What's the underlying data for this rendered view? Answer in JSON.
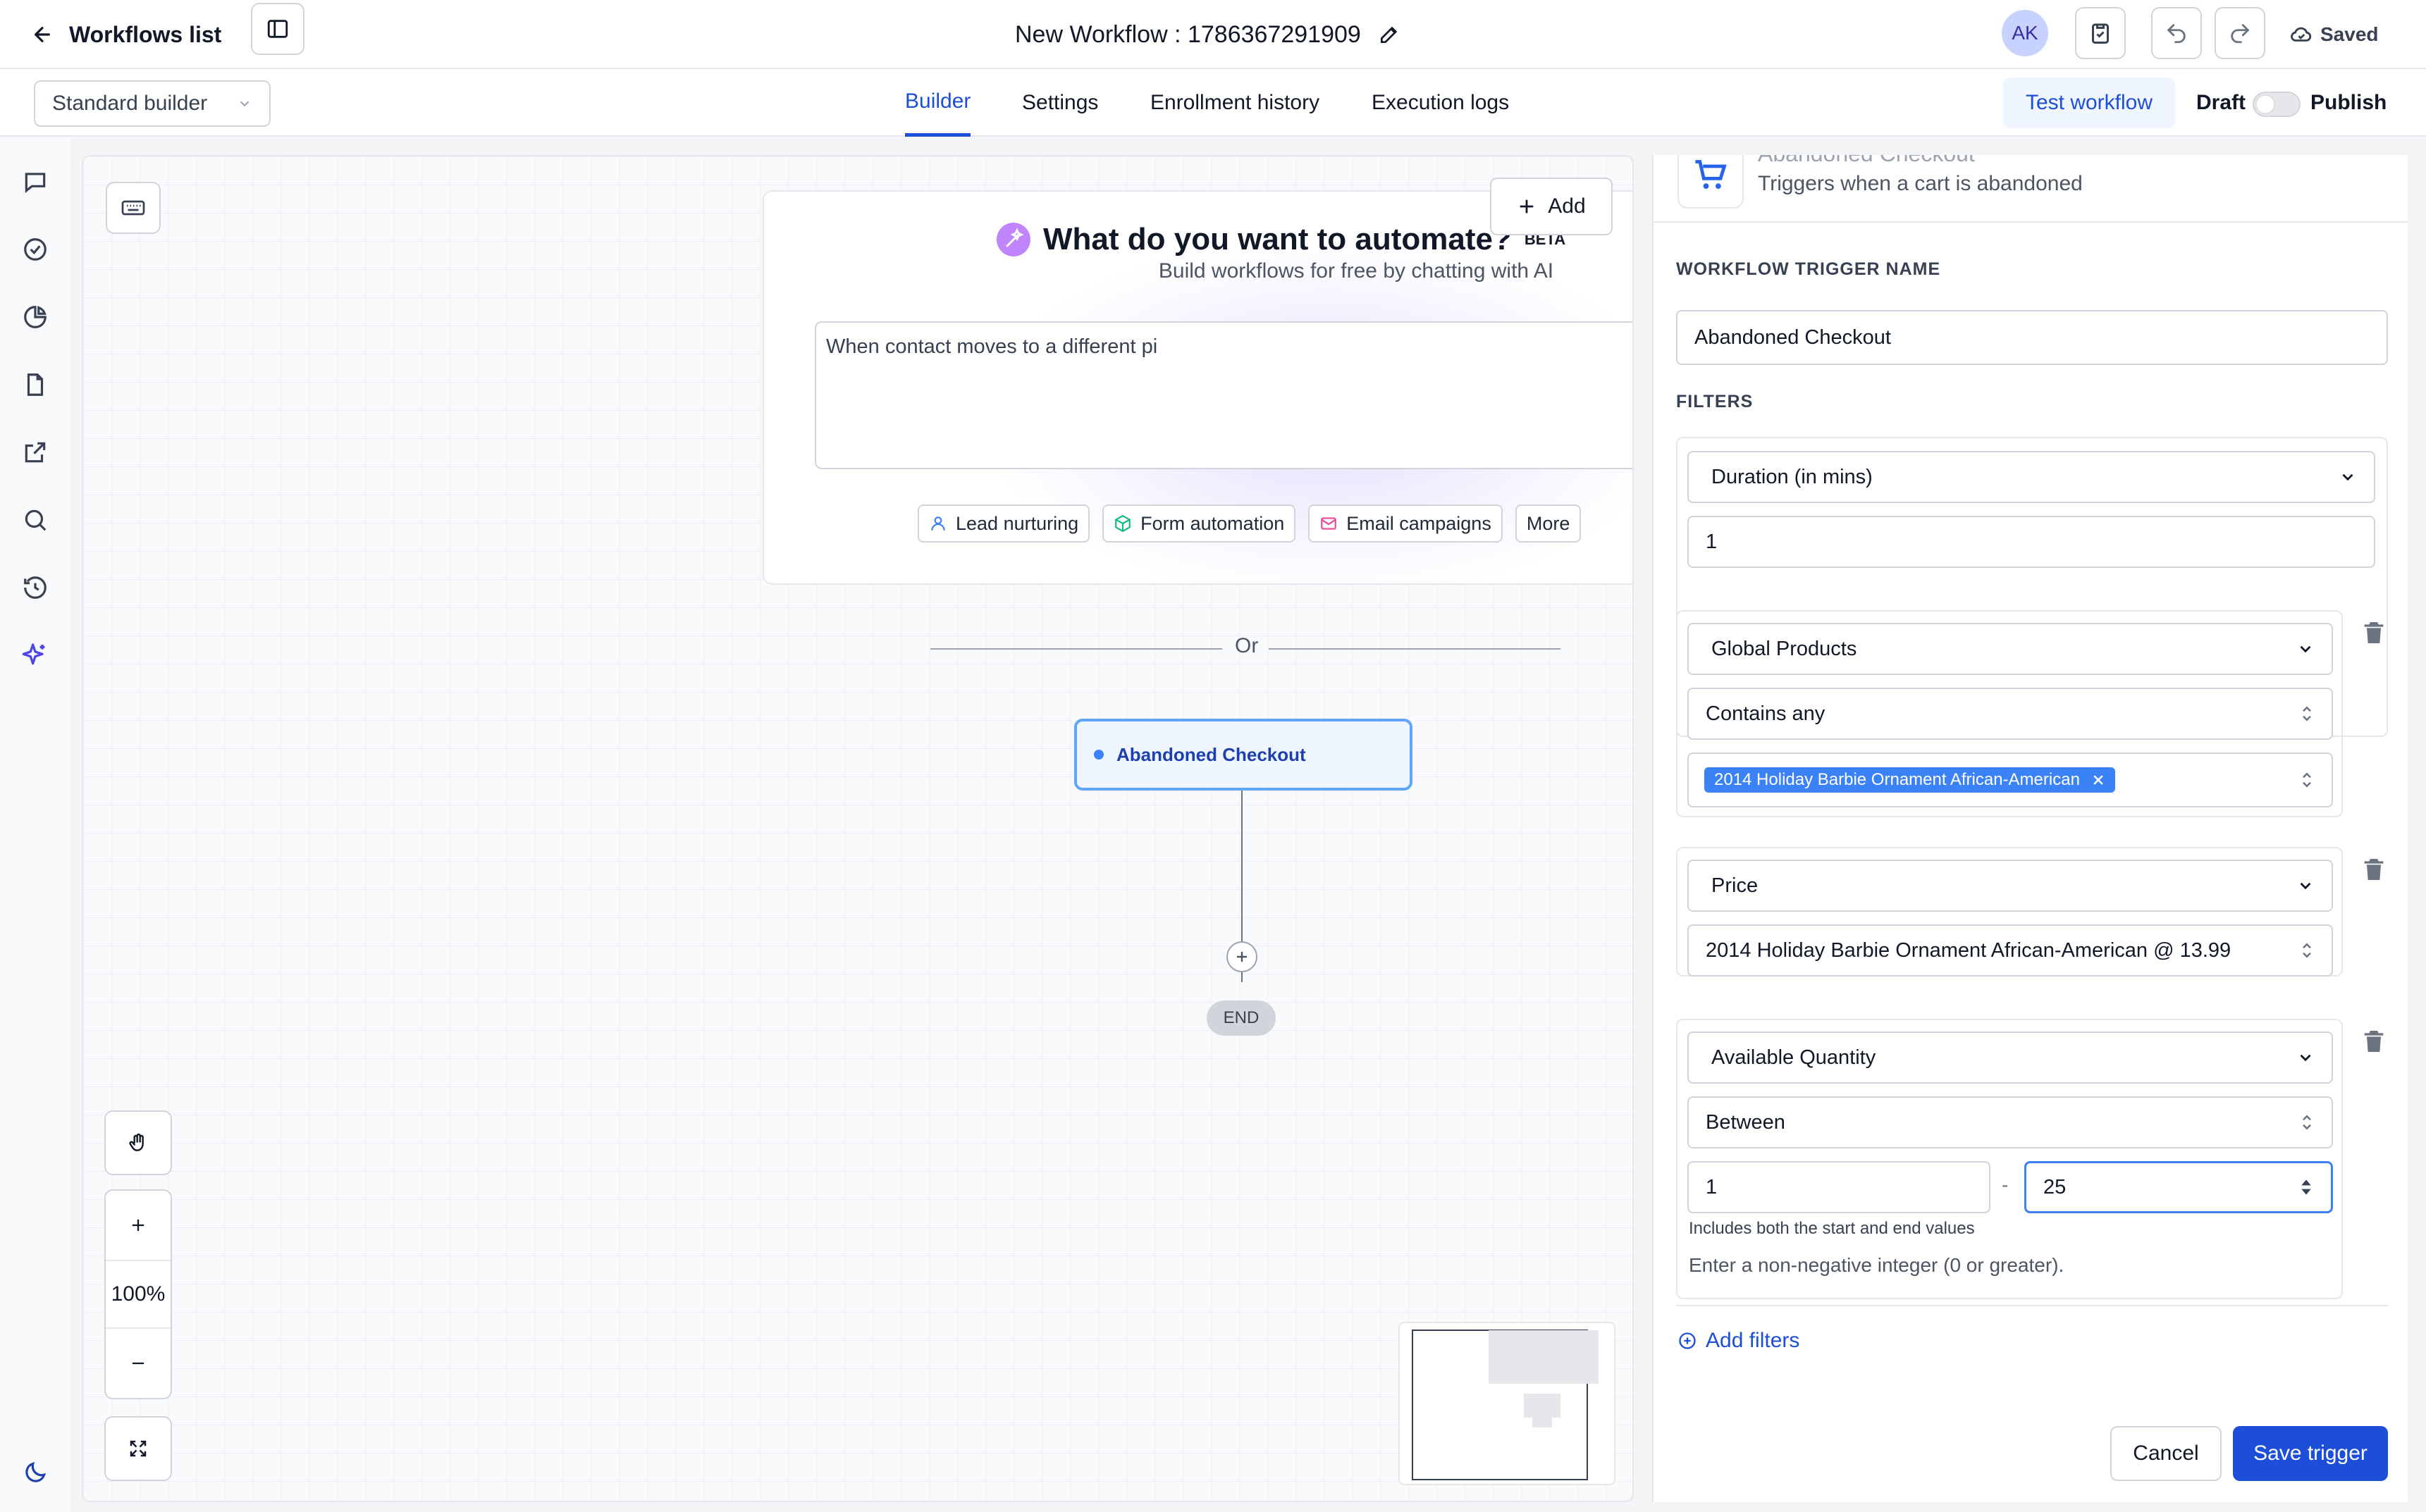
{
  "header": {
    "back_label": "Workflows list",
    "workflow_title": "New Workflow : 1786367291909",
    "avatar_initials": "AK",
    "saved_label": "Saved"
  },
  "subbar": {
    "builder_mode": "Standard builder",
    "tabs": [
      {
        "label": "Builder",
        "active": true
      },
      {
        "label": "Settings",
        "active": false
      },
      {
        "label": "Enrollment history",
        "active": false
      },
      {
        "label": "Execution logs",
        "active": false
      }
    ],
    "test_label": "Test workflow",
    "draft_label": "Draft",
    "publish_label": "Publish"
  },
  "canvas": {
    "ai_title": "What do you want to automate?",
    "ai_badge": "BETA",
    "ai_subtitle": "Build workflows for free by chatting with AI",
    "ai_input_value": "When contact moves to a different pi",
    "chips": [
      "Lead nurturing",
      "Form automation",
      "Email campaigns",
      "More"
    ],
    "add_label": "Add",
    "or_label": "Or",
    "trigger_node": "Abandoned Checkout",
    "end_label": "END",
    "zoom_level": "100%"
  },
  "panel": {
    "trigger_title": "Abandoned Checkout",
    "trigger_desc": "Triggers when a cart is abandoned",
    "name_label": "WORKFLOW TRIGGER NAME",
    "name_value": "Abandoned Checkout",
    "filters_label": "FILTERS",
    "filter1_field": "Duration (in mins)",
    "filter1_value": "1",
    "filter2_field": "Global Products",
    "filter2_op": "Contains any",
    "filter2_tag": "2014 Holiday Barbie Ornament African-American",
    "filter3_field": "Price",
    "filter3_value": "2014 Holiday Barbie Ornament African-American @ 13.99",
    "filter4_field": "Available Quantity",
    "filter4_op": "Between",
    "filter4_min": "1",
    "filter4_dash": "-",
    "filter4_max": "25",
    "filter4_hint": "Includes both the start and end values",
    "filter4_help": "Enter a non-negative integer (0 or greater).",
    "add_filters_label": "Add filters",
    "cancel_label": "Cancel",
    "save_label": "Save trigger"
  },
  "colors": {
    "accent": "#1d4ed8",
    "node_border": "#60a5fa",
    "tag_bg": "#3b82f6"
  }
}
